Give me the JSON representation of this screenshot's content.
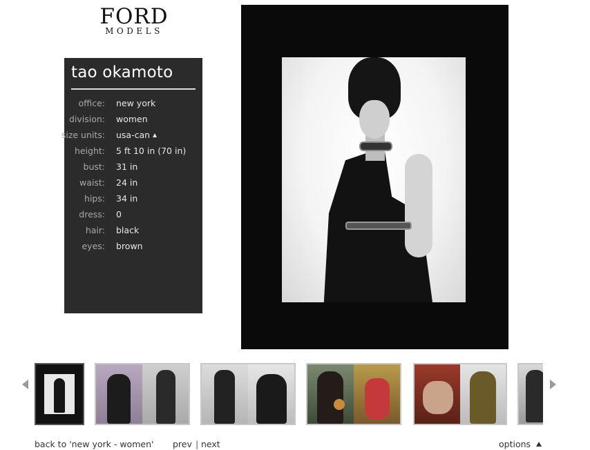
{
  "brand": {
    "name": "FORD",
    "sub": "MODELS"
  },
  "model": {
    "name": "tao okamoto",
    "stats": [
      {
        "label": "office:",
        "value": "new york"
      },
      {
        "label": "division:",
        "value": "women"
      },
      {
        "label": "size units:",
        "value": "usa-can"
      },
      {
        "label": "height:",
        "value": "5 ft 10 in (70 in)"
      },
      {
        "label": "bust:",
        "value": "31 in"
      },
      {
        "label": "waist:",
        "value": "24 in"
      },
      {
        "label": "hips:",
        "value": "34 in"
      },
      {
        "label": "dress:",
        "value": "0"
      },
      {
        "label": "hair:",
        "value": "black"
      },
      {
        "label": "eyes:",
        "value": "brown"
      }
    ]
  },
  "footer": {
    "back_label": "back to 'new york - women'",
    "prev_label": "prev",
    "separator": "|",
    "next_label": "next",
    "options_label": "options"
  },
  "colors": {
    "panel_bg": "#2b2b2b",
    "photo_bg": "#0a0a0a",
    "thumb_border": "#c8c8c8",
    "thumb_active_border": "#555555"
  },
  "icons": {
    "size_units_toggle": "triangle-up-icon",
    "options_toggle": "triangle-up-icon",
    "scroll_left": "triangle-left-icon",
    "scroll_right": "triangle-right-icon"
  }
}
